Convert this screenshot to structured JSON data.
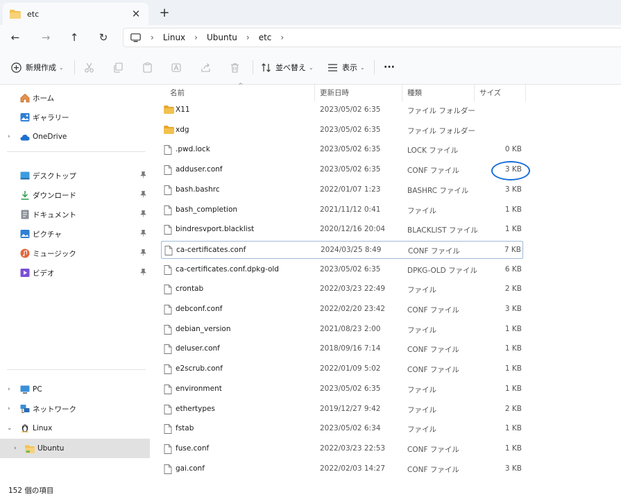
{
  "tab": {
    "title": "etc",
    "close_glyph": "✕",
    "new_tab_glyph": "+"
  },
  "nav": {
    "back_glyph": "←",
    "forward_glyph": "→",
    "up_glyph": "↑",
    "refresh_glyph": "↻",
    "breadcrumbs": [
      "Linux",
      "Ubuntu",
      "etc"
    ],
    "sep_glyph": "›"
  },
  "toolbar": {
    "new_label": "新規作成",
    "sort_label": "並べ替え",
    "view_label": "表示",
    "more_glyph": "···",
    "chevron_glyph": "⌄"
  },
  "sidebar": {
    "quick": [
      {
        "label": "ホーム",
        "icon": "home-icon"
      },
      {
        "label": "ギャラリー",
        "icon": "gallery-icon"
      },
      {
        "label": "OneDrive",
        "icon": "cloud-icon"
      }
    ],
    "pinned": [
      {
        "label": "デスクトップ",
        "icon": "desktop-icon"
      },
      {
        "label": "ダウンロード",
        "icon": "download-icon"
      },
      {
        "label": "ドキュメント",
        "icon": "document-icon"
      },
      {
        "label": "ピクチャ",
        "icon": "pictures-icon"
      },
      {
        "label": "ミュージック",
        "icon": "music-icon"
      },
      {
        "label": "ビデオ",
        "icon": "video-icon"
      }
    ],
    "tree": [
      {
        "label": "PC",
        "icon": "pc-icon"
      },
      {
        "label": "ネットワーク",
        "icon": "network-icon"
      },
      {
        "label": "Linux",
        "icon": "linux-icon"
      },
      {
        "label": "Ubuntu",
        "icon": "folder-icon"
      }
    ],
    "chevron_right": "›",
    "chevron_down": "⌄",
    "pin_glyph": "📌"
  },
  "columns": {
    "name": "名前",
    "date": "更新日時",
    "type": "種類",
    "size": "サイズ",
    "sort_glyph": "^"
  },
  "files": [
    {
      "name": "X11",
      "date": "2023/05/02 6:35",
      "type": "ファイル フォルダー",
      "size": "",
      "kind": "folder"
    },
    {
      "name": "xdg",
      "date": "2023/05/02 6:35",
      "type": "ファイル フォルダー",
      "size": "",
      "kind": "folder"
    },
    {
      "name": ".pwd.lock",
      "date": "2023/05/02 6:35",
      "type": "LOCK ファイル",
      "size": "0 KB",
      "kind": "file"
    },
    {
      "name": "adduser.conf",
      "date": "2023/05/02 6:35",
      "type": "CONF ファイル",
      "size": "3 KB",
      "kind": "file"
    },
    {
      "name": "bash.bashrc",
      "date": "2022/01/07 1:23",
      "type": "BASHRC ファイル",
      "size": "3 KB",
      "kind": "file"
    },
    {
      "name": "bash_completion",
      "date": "2021/11/12 0:41",
      "type": "ファイル",
      "size": "1 KB",
      "kind": "file"
    },
    {
      "name": "bindresvport.blacklist",
      "date": "2020/12/16 20:04",
      "type": "BLACKLIST ファイル",
      "size": "1 KB",
      "kind": "file"
    },
    {
      "name": "ca-certificates.conf",
      "date": "2024/03/25 8:49",
      "type": "CONF ファイル",
      "size": "7 KB",
      "kind": "file"
    },
    {
      "name": "ca-certificates.conf.dpkg-old",
      "date": "2023/05/02 6:35",
      "type": "DPKG-OLD ファイル",
      "size": "6 KB",
      "kind": "file"
    },
    {
      "name": "crontab",
      "date": "2022/03/23 22:49",
      "type": "ファイル",
      "size": "2 KB",
      "kind": "file"
    },
    {
      "name": "debconf.conf",
      "date": "2022/02/20 23:42",
      "type": "CONF ファイル",
      "size": "3 KB",
      "kind": "file"
    },
    {
      "name": "debian_version",
      "date": "2021/08/23 2:00",
      "type": "ファイル",
      "size": "1 KB",
      "kind": "file"
    },
    {
      "name": "deluser.conf",
      "date": "2018/09/16 7:14",
      "type": "CONF ファイル",
      "size": "1 KB",
      "kind": "file"
    },
    {
      "name": "e2scrub.conf",
      "date": "2022/01/09 5:02",
      "type": "CONF ファイル",
      "size": "1 KB",
      "kind": "file"
    },
    {
      "name": "environment",
      "date": "2023/05/02 6:35",
      "type": "ファイル",
      "size": "1 KB",
      "kind": "file"
    },
    {
      "name": "ethertypes",
      "date": "2019/12/27 9:42",
      "type": "ファイル",
      "size": "2 KB",
      "kind": "file"
    },
    {
      "name": "fstab",
      "date": "2023/05/02 6:34",
      "type": "ファイル",
      "size": "1 KB",
      "kind": "file"
    },
    {
      "name": "fuse.conf",
      "date": "2022/03/23 22:53",
      "type": "CONF ファイル",
      "size": "1 KB",
      "kind": "file"
    },
    {
      "name": "gai.conf",
      "date": "2022/02/03 14:27",
      "type": "CONF ファイル",
      "size": "3 KB",
      "kind": "file"
    }
  ],
  "status": {
    "count": "152 個の項目"
  },
  "colors": {
    "folder": "#f2c14e",
    "accent": "#1a6ed8",
    "selected": "#e1e1e1"
  }
}
